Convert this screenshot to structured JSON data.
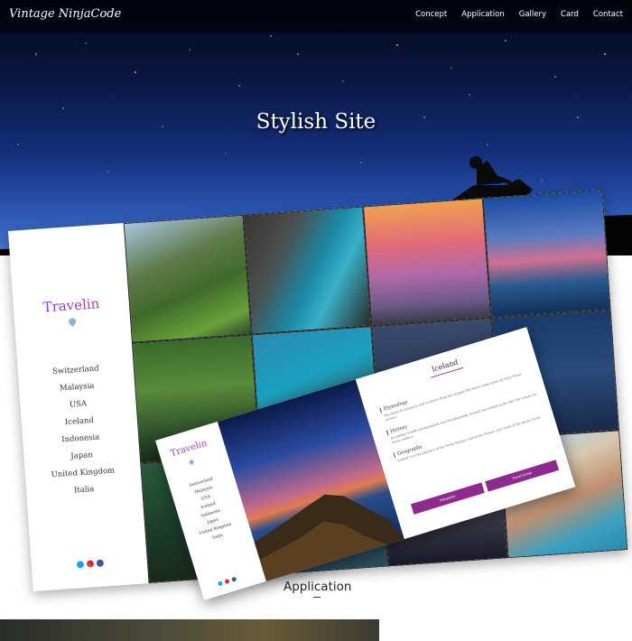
{
  "header": {
    "logo": "Vintage NinjaCode",
    "nav": [
      "Concept",
      "Application",
      "Gallery",
      "Card",
      "Contact"
    ]
  },
  "hero": {
    "title": "Stylish Site"
  },
  "mockup_large": {
    "brand": "Travelin",
    "menu": [
      "Switzerland",
      "Malaysia",
      "USA",
      "Iceland",
      "Indonesia",
      "Japan",
      "United Kingdom",
      "Italia"
    ],
    "social_icons": [
      "twitter-icon",
      "instagram-icon",
      "facebook-icon"
    ]
  },
  "mockup_small": {
    "brand": "Travelin",
    "menu": [
      "Switzerland",
      "Malaysia",
      "USA",
      "Iceland",
      "Indonesia",
      "Japan",
      "United Kingdom",
      "Italia"
    ],
    "panel": {
      "title": "Iceland",
      "sections": [
        {
          "heading": "Etymology",
          "text": "The name of Iceland is said to derive from the original Old Norse name given by early Norse settlers."
        },
        {
          "heading": "History",
          "text": "According to both Landnámabók and Íslendingabók, Iceland was settled in the late 9th century by Norse settlers."
        },
        {
          "heading": "Geography",
          "text": "Iceland is at the juncture of the North Atlantic and Arctic Oceans, just south of the Arctic Circle."
        }
      ],
      "buttons": [
        "Wikipedia",
        "Travel Guide"
      ]
    }
  },
  "section": {
    "caption": "Application"
  },
  "colors": {
    "accent": "#8e2a8e",
    "brand_start": "#6a3bd6",
    "brand_end": "#c23da8"
  }
}
